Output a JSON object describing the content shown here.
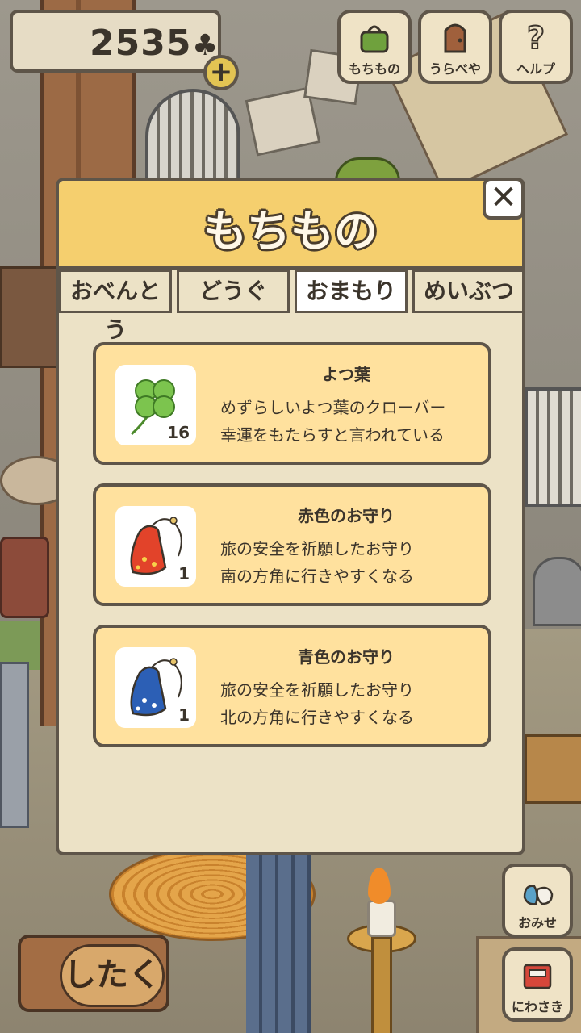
{
  "hud": {
    "clover_count": "2535",
    "clover_icon": "clover-icon",
    "plus_label": "+",
    "buttons": {
      "bag": "もちもの",
      "back_room": "うらべや",
      "help": "ヘルプ"
    }
  },
  "bottom": {
    "shop": "おみせ",
    "garden": "にわさき",
    "prepare": "したく"
  },
  "dialog": {
    "title": "もちもの",
    "close_label": "✕",
    "tabs": [
      {
        "label": "おべんとう",
        "active": false
      },
      {
        "label": "どうぐ",
        "active": false
      },
      {
        "label": "おまもり",
        "active": true
      },
      {
        "label": "めいぶつ",
        "active": false
      }
    ],
    "items": [
      {
        "name": "よつ葉",
        "icon": "four-leaf-clover-icon",
        "quantity": "16",
        "desc_line1": "めずらしいよつ葉のクローバー",
        "desc_line2": "幸運をもたらすと言われている"
      },
      {
        "name": "赤色のお守り",
        "icon": "red-charm-icon",
        "quantity": "1",
        "desc_line1": "旅の安全を祈願したお守り",
        "desc_line2": "南の方角に行きやすくなる"
      },
      {
        "name": "青色のお守り",
        "icon": "blue-charm-icon",
        "quantity": "1",
        "desc_line1": "旅の安全を祈願したお守り",
        "desc_line2": "北の方角に行きやすくなる"
      }
    ]
  },
  "colors": {
    "header_yellow": "#f5cf6e",
    "card_yellow": "#ffe19e",
    "panel_beige": "#ece2c6",
    "outline": "#5e5549",
    "red_charm": "#e2432a",
    "blue_charm": "#2c5fb5",
    "clover_green": "#7cc44e"
  }
}
